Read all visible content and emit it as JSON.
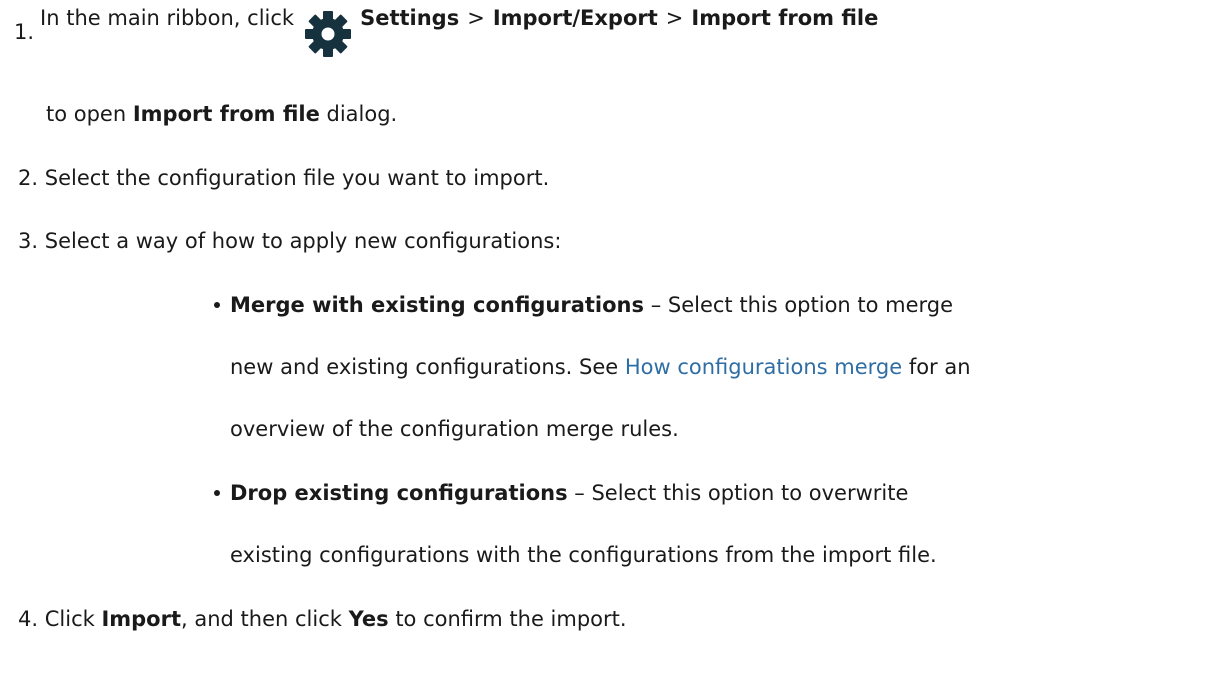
{
  "steps": [
    {
      "num": "1.",
      "intro": "In the main ribbon, click",
      "icon": "gear-icon",
      "path": [
        "Settings",
        "Import/Export",
        "Import from file"
      ],
      "separator": ">",
      "cont_pre": "to open ",
      "cont_bold": "Import from file",
      "cont_post": " dialog."
    },
    {
      "num": "2.",
      "text": "Select the configuration file you want to import."
    },
    {
      "num": "3.",
      "text": "Select a way of how to apply new configurations:"
    },
    {
      "num": "4.",
      "pre": "Click ",
      "bold1": "Import",
      "mid": ", and then click ",
      "bold2": "Yes",
      "post": " to confirm the import."
    }
  ],
  "options": [
    {
      "title": "Merge with existing configurations",
      "dash": " – ",
      "line1": "Select this option to merge",
      "line2_pre": "new and existing configurations. See ",
      "line2_link": "How configurations merge",
      "line2_post": " for an",
      "line3": "overview of the configuration merge rules."
    },
    {
      "title": "Drop existing configurations",
      "dash": " – ",
      "line1": "Select this option to overwrite",
      "line2": "existing configurations with the configurations from the import file."
    }
  ],
  "colors": {
    "gear": "#17323f",
    "link": "#2f6ea5",
    "text": "#1a1a1a"
  }
}
